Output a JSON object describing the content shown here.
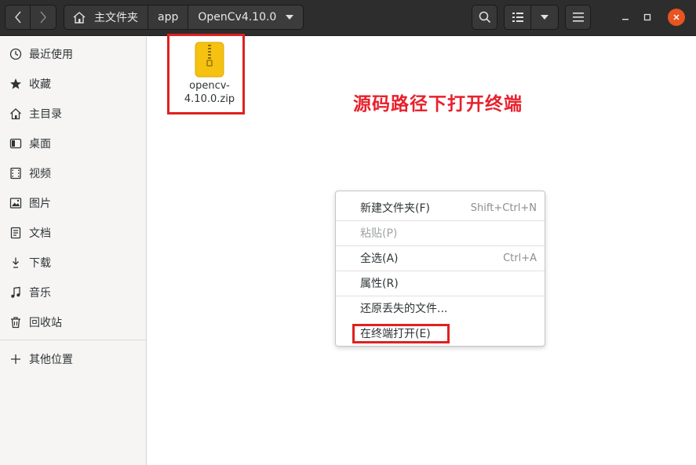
{
  "header": {
    "breadcrumbs": [
      "主文件夹",
      "app",
      "OpenCv4.10.0"
    ]
  },
  "sidebar": {
    "items": [
      {
        "label": "最近使用",
        "icon": "clock-icon"
      },
      {
        "label": "收藏",
        "icon": "star-icon"
      },
      {
        "label": "主目录",
        "icon": "home-icon"
      },
      {
        "label": "桌面",
        "icon": "desktop-icon"
      },
      {
        "label": "视频",
        "icon": "video-icon"
      },
      {
        "label": "图片",
        "icon": "image-icon"
      },
      {
        "label": "文档",
        "icon": "document-icon"
      },
      {
        "label": "下载",
        "icon": "download-icon"
      },
      {
        "label": "音乐",
        "icon": "music-icon"
      },
      {
        "label": "回收站",
        "icon": "trash-icon"
      }
    ],
    "other_locations": "其他位置"
  },
  "files": [
    {
      "name_line1": "opencv-",
      "name_line2": "4.10.0.zip",
      "icon": "zip-archive-icon"
    }
  ],
  "annotation": "源码路径下打开终端",
  "context_menu": {
    "items": [
      {
        "label": "新建文件夹(F)",
        "accel": "Shift+Ctrl+N",
        "enabled": true
      },
      {
        "label": "粘贴(P)",
        "accel": "",
        "enabled": false
      },
      {
        "label": "全选(A)",
        "accel": "Ctrl+A",
        "enabled": true
      },
      {
        "label": "属性(R)",
        "accel": "",
        "enabled": true
      },
      {
        "label": "还原丢失的文件...",
        "accel": "",
        "enabled": true
      },
      {
        "label": "在终端打开(E)",
        "accel": "",
        "enabled": true
      }
    ]
  },
  "colors": {
    "headerbar": "#2d2d2d",
    "close_button": "#e95420",
    "highlight_box": "#e02020",
    "annotation": "#e8212d"
  }
}
